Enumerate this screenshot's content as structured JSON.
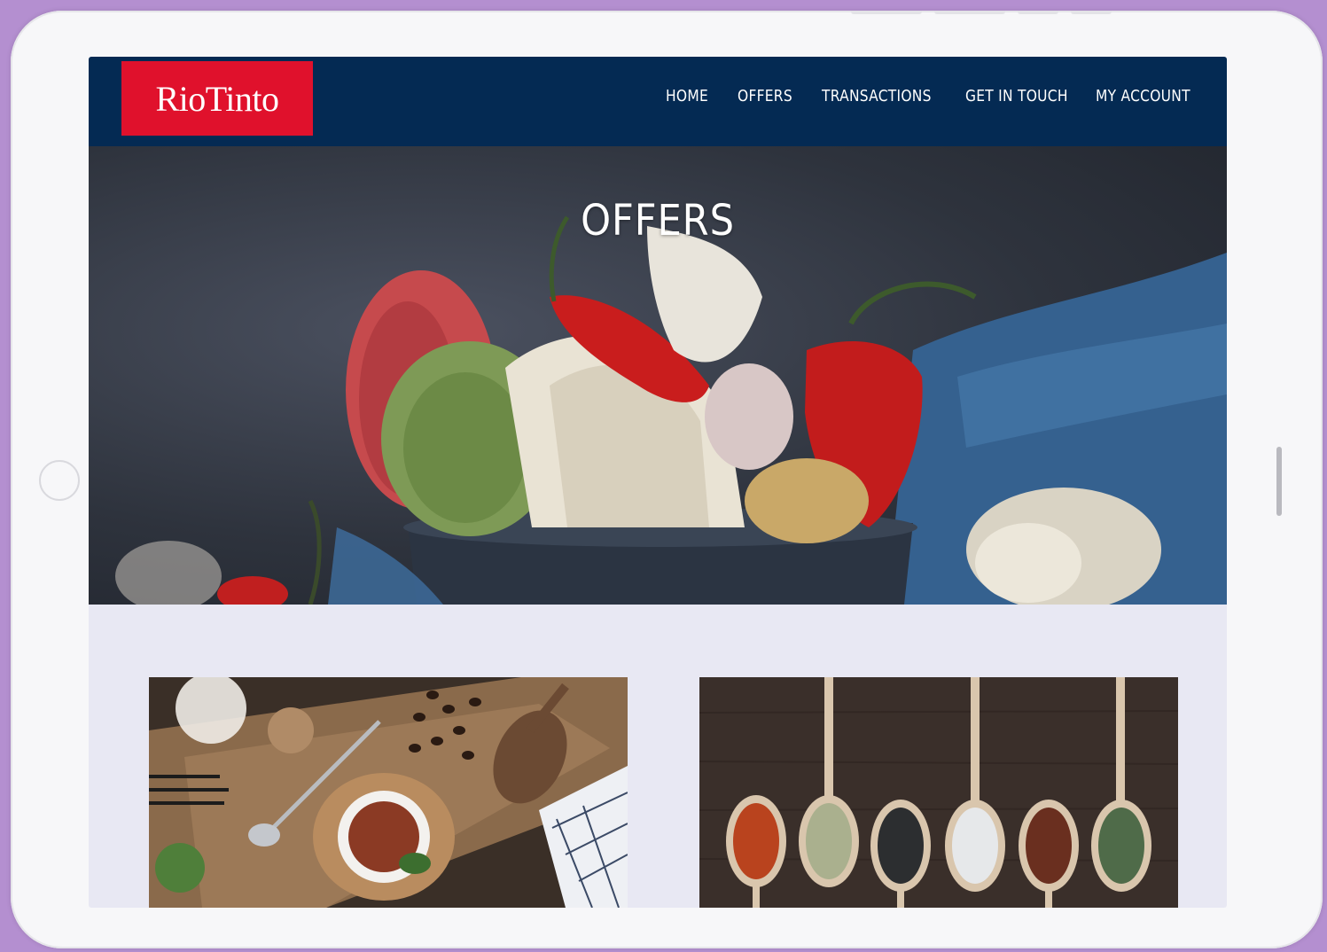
{
  "brand": {
    "logo_text": "RioTinto",
    "logo_color": "#e0112c"
  },
  "nav": {
    "background": "#042a53",
    "items": [
      {
        "label": "HOME"
      },
      {
        "label": "OFFERS"
      },
      {
        "label": "TRANSACTIONS"
      },
      {
        "label": "GET IN TOUCH"
      },
      {
        "label": "MY ACCOUNT"
      }
    ]
  },
  "hero": {
    "title": "OFFERS",
    "image": "noodles-peppers-garlic-photo"
  },
  "offers": [
    {
      "image": "spices-cutting-board-photo"
    },
    {
      "image": "spice-spoons-photo"
    }
  ],
  "device": {
    "type": "tablet-frame",
    "accent": "#b48fd0"
  }
}
